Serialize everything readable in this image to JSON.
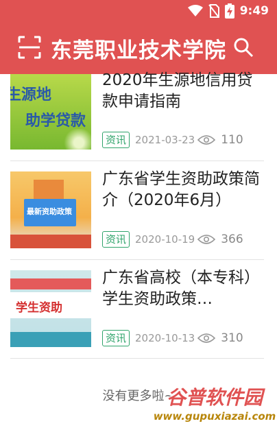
{
  "status_bar": {
    "time": "9:49",
    "icons": [
      "wifi-icon",
      "no-sim-icon",
      "battery-charging-icon"
    ]
  },
  "app_bar": {
    "title": "东莞职业技术学院",
    "left_icon": "scan-icon",
    "right_icon": "search-icon"
  },
  "articles": [
    {
      "title": "2020年生源地信用贷款申请指南",
      "tag": "资讯",
      "date": "2021-03-23",
      "views": "110",
      "thumb_text": [
        "生源地",
        "助学贷款"
      ]
    },
    {
      "title": "广东省学生资助政策简介（2020年6月）",
      "tag": "资讯",
      "date": "2020-10-19",
      "views": "366",
      "thumb_text": [
        "最新资助政策"
      ]
    },
    {
      "title": "广东省高校（本专科）学生资助政策…",
      "tag": "资讯",
      "date": "2020-10-13",
      "views": "310",
      "thumb_text": [
        "学生资助"
      ]
    }
  ],
  "footer_text": "没有更多啦~",
  "watermark": {
    "title": "谷普软件园",
    "url": "www.gupuxiazai.com"
  },
  "colors": {
    "brand": "#e05252",
    "tag": "#2ea36a"
  }
}
